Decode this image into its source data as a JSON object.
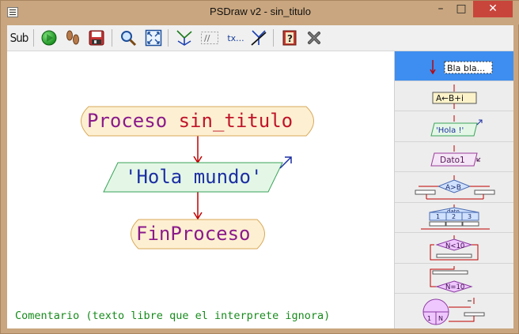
{
  "window": {
    "title": "PSDraw v2 - sin_titulo",
    "controls": {
      "minimize": "–",
      "maximize": "□",
      "close": "✕"
    }
  },
  "toolbar": {
    "items": [
      {
        "name": "sub",
        "label": "Sub",
        "icon": "sub-text-icon"
      },
      {
        "name": "run",
        "icon": "play-icon"
      },
      {
        "name": "step",
        "icon": "footprints-icon"
      },
      {
        "name": "save",
        "icon": "save-icon"
      },
      {
        "name": "zoom",
        "icon": "magnifier-icon"
      },
      {
        "name": "fit",
        "icon": "fit-screen-icon"
      },
      {
        "name": "toggle-arrows",
        "icon": "arrows-icon"
      },
      {
        "name": "toggle-comments",
        "label": "//",
        "icon": "comments-icon"
      },
      {
        "name": "toggle-text",
        "label": "tx...",
        "icon": "text-icon"
      },
      {
        "name": "style",
        "icon": "style-icon"
      },
      {
        "name": "help",
        "icon": "help-book-icon"
      },
      {
        "name": "close",
        "icon": "close-x-icon"
      }
    ]
  },
  "diagram": {
    "start_keyword": "Proceso",
    "process_name": "sin_titulo",
    "output_text": "'Hola mundo'",
    "end_label": "FinProceso",
    "comment": "Comentario (texto libre que el interprete ignora)"
  },
  "palette": {
    "items": [
      {
        "name": "comment",
        "label": "Bla bla...",
        "selected": true
      },
      {
        "name": "assign",
        "label": "A←B+i"
      },
      {
        "name": "write",
        "label": "'Hola !'"
      },
      {
        "name": "read",
        "label": "Dato1"
      },
      {
        "name": "if",
        "label": "A>B"
      },
      {
        "name": "switch",
        "label": "dato",
        "cases": [
          "1",
          "2",
          "3"
        ]
      },
      {
        "name": "while",
        "label": "N<10"
      },
      {
        "name": "repeat",
        "label": "N=10"
      },
      {
        "name": "for",
        "label": "1",
        "extra": "N"
      }
    ]
  },
  "colors": {
    "accent": "#3d8ef0",
    "keyword": "#8b1a8b",
    "identifier": "#c0142a",
    "string": "#1c2fa3",
    "arrow": "#c00000",
    "comment": "#178b1c",
    "terminal_fill": "#fdf0d2",
    "io_fill": "#e4f7e6"
  }
}
